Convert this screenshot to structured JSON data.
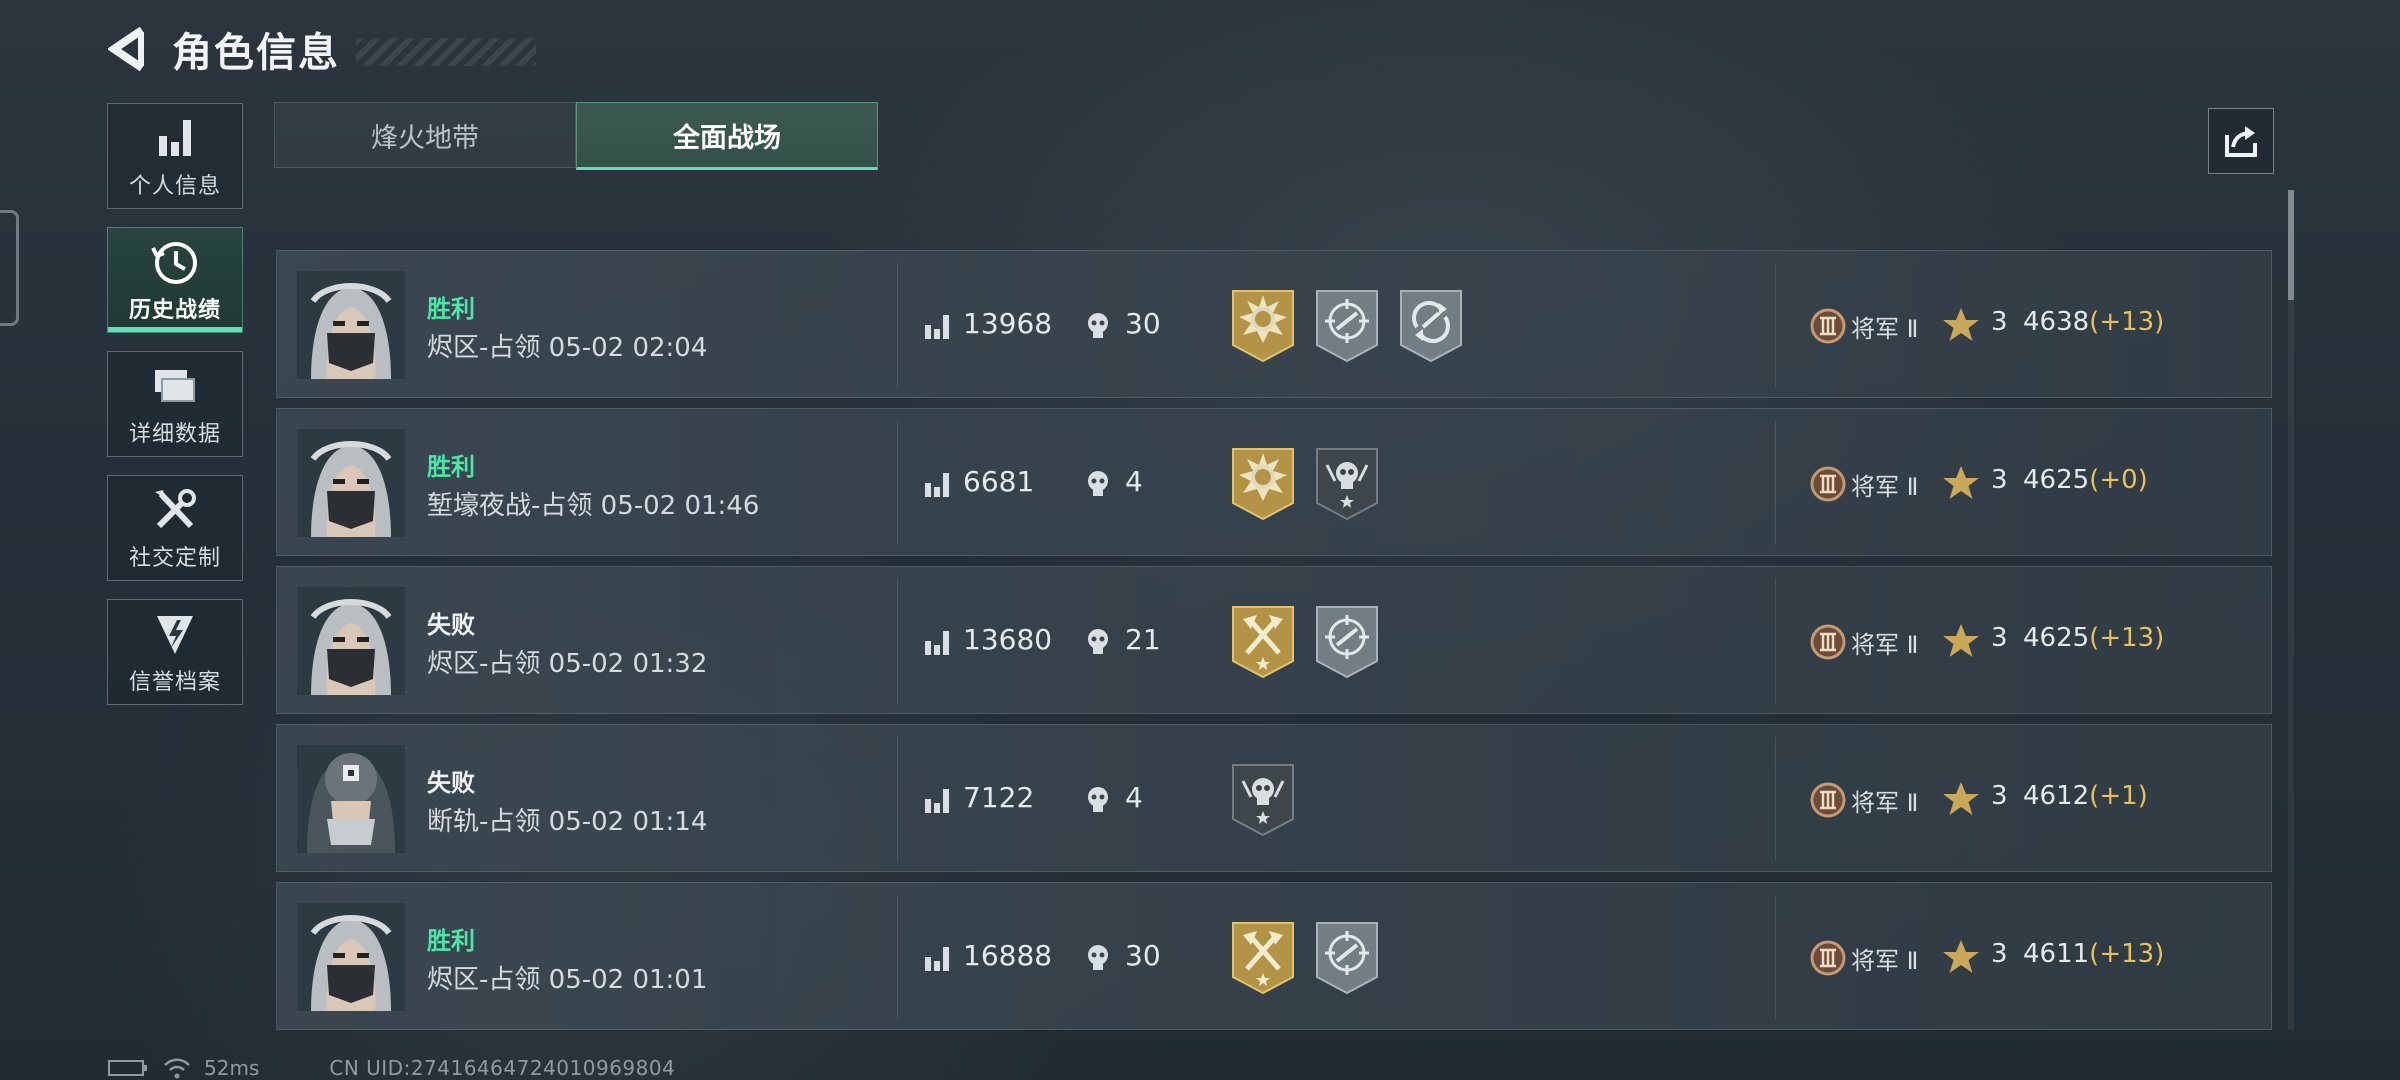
{
  "header": {
    "title": "角色信息"
  },
  "sidebar": {
    "items": [
      {
        "label": "个人信息",
        "icon": "bar-chart-icon"
      },
      {
        "label": "历史战绩",
        "icon": "history-clock-icon"
      },
      {
        "label": "详细数据",
        "icon": "stacked-cards-icon"
      },
      {
        "label": "社交定制",
        "icon": "tools-icon"
      },
      {
        "label": "信誉档案",
        "icon": "reputation-shield-icon"
      }
    ],
    "active_index": 1
  },
  "tabs": [
    {
      "label": "烽火地带"
    },
    {
      "label": "全面战场"
    }
  ],
  "active_tab_index": 1,
  "matches": [
    {
      "result": "胜利",
      "outcome": "win",
      "map": "烬区-占领 05-02 02:04",
      "score": "13968",
      "kills": "30",
      "medals": [
        "gold-sunburst-medal-icon",
        "silver-crosshair-medal-icon",
        "silver-recycle-medal-icon"
      ],
      "rank": "将军 Ⅱ",
      "stars": "3",
      "points": "4638",
      "delta": "(+13)"
    },
    {
      "result": "胜利",
      "outcome": "win",
      "map": "堑壕夜战-占领 05-02 01:46",
      "score": "6681",
      "kills": "4",
      "medals": [
        "gold-sunburst-medal-icon",
        "dark-skull-medal-icon"
      ],
      "rank": "将军 Ⅱ",
      "stars": "3",
      "points": "4625",
      "delta": "(+0)"
    },
    {
      "result": "失败",
      "outcome": "lose",
      "map": "烬区-占领 05-02 01:32",
      "score": "13680",
      "kills": "21",
      "medals": [
        "gold-axes-medal-icon",
        "silver-crosshair-medal-icon"
      ],
      "rank": "将军 Ⅱ",
      "stars": "3",
      "points": "4625",
      "delta": "(+13)"
    },
    {
      "result": "失败",
      "outcome": "lose",
      "map": "断轨-占领 05-02 01:14",
      "score": "7122",
      "kills": "4",
      "medals": [
        "dark-skull-medal-icon"
      ],
      "rank": "将军 Ⅱ",
      "stars": "3",
      "points": "4612",
      "delta": "(+1)"
    },
    {
      "result": "胜利",
      "outcome": "win",
      "map": "烬区-占领 05-02 01:01",
      "score": "16888",
      "kills": "30",
      "medals": [
        "gold-axes-medal-icon",
        "silver-crosshair-medal-icon"
      ],
      "rank": "将军 Ⅱ",
      "stars": "3",
      "points": "4611",
      "delta": "(+13)"
    }
  ],
  "footer": {
    "ping": "52ms",
    "uid": "CN UID:27416464724010969804"
  },
  "colors": {
    "win": "#4de6a8",
    "accent": "#5fe0b4",
    "delta": "#e6c15a"
  }
}
